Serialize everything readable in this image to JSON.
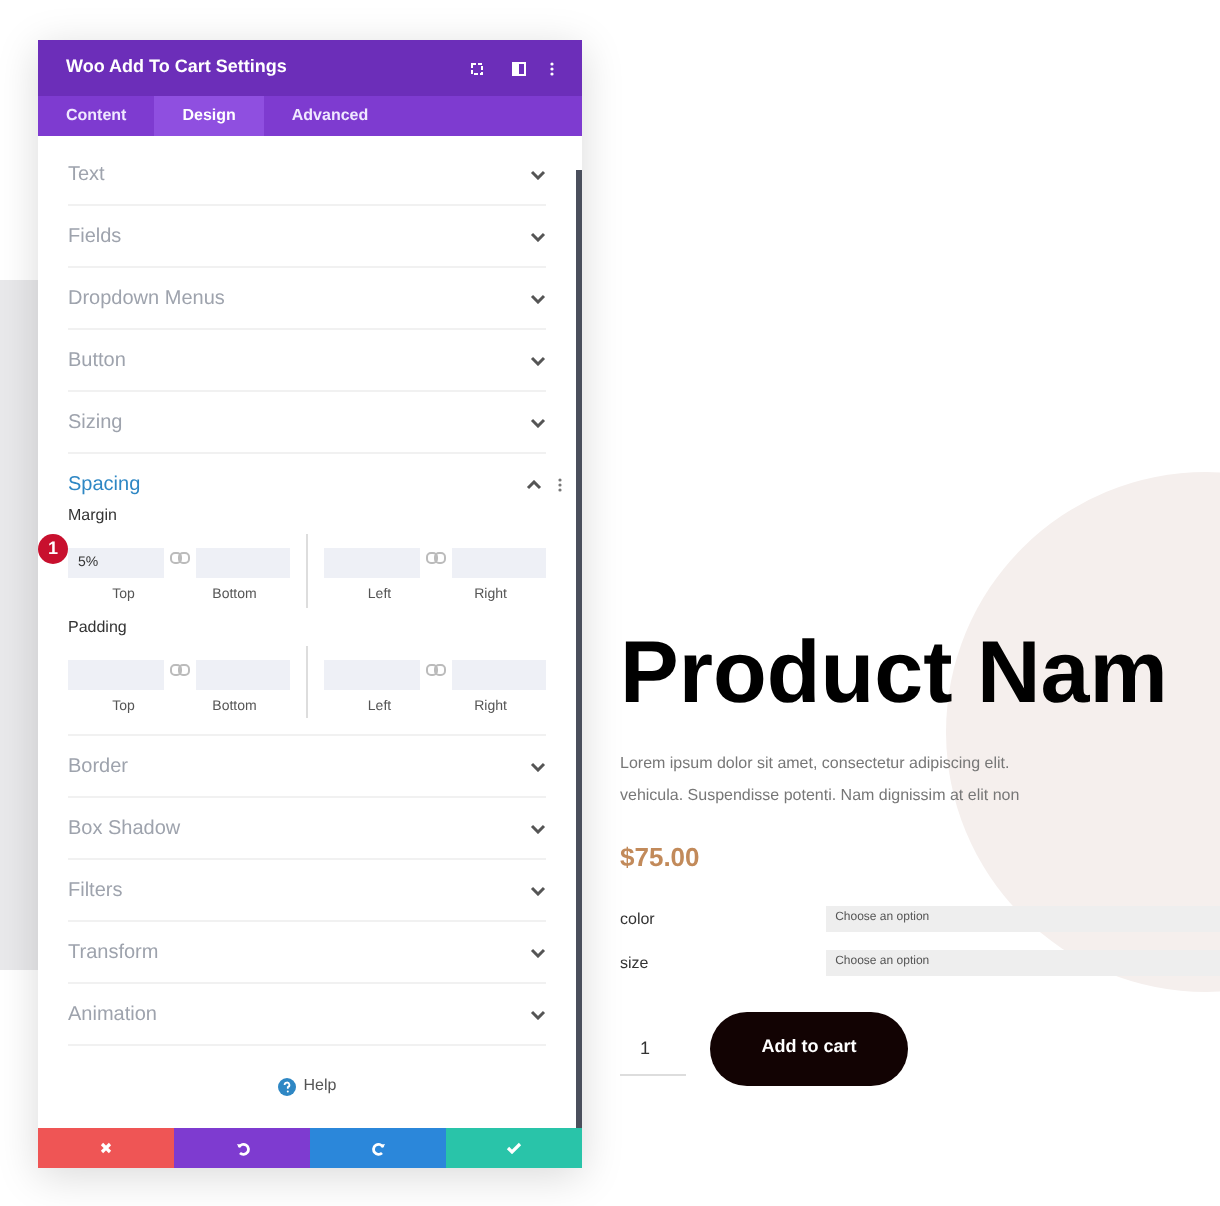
{
  "panel": {
    "title": "Woo Add To Cart Settings",
    "tabs": [
      {
        "label": "Content",
        "selected": false
      },
      {
        "label": "Design",
        "selected": true
      },
      {
        "label": "Advanced",
        "selected": false
      }
    ],
    "sections": [
      {
        "label": "Text",
        "expanded": false
      },
      {
        "label": "Fields",
        "expanded": false
      },
      {
        "label": "Dropdown Menus",
        "expanded": false
      },
      {
        "label": "Button",
        "expanded": false
      },
      {
        "label": "Sizing",
        "expanded": false
      },
      {
        "label": "Spacing",
        "expanded": true,
        "groups": [
          {
            "label": "Margin",
            "fields": [
              {
                "caption": "Top",
                "value": "5%"
              },
              {
                "caption": "Bottom"
              },
              {
                "caption": "Left"
              },
              {
                "caption": "Right"
              }
            ]
          },
          {
            "label": "Padding",
            "fields": [
              {
                "caption": "Top"
              },
              {
                "caption": "Bottom"
              },
              {
                "caption": "Left"
              },
              {
                "caption": "Right"
              }
            ]
          }
        ]
      },
      {
        "label": "Border",
        "expanded": false
      },
      {
        "label": "Box Shadow",
        "expanded": false
      },
      {
        "label": "Filters",
        "expanded": false
      },
      {
        "label": "Transform",
        "expanded": false
      },
      {
        "label": "Animation",
        "expanded": false
      }
    ],
    "help": "Help",
    "step_badge": "1"
  },
  "product": {
    "name": "Product Nam",
    "description": [
      "Lorem ipsum dolor sit amet, consectetur adipiscing elit.",
      "vehicula. Suspendisse potenti. Nam dignissim at elit non"
    ],
    "price": "$75.00",
    "options": [
      {
        "label": "color",
        "placeholder": "Choose an option"
      },
      {
        "label": "size",
        "placeholder": "Choose an option"
      }
    ],
    "quantity": "1",
    "button": "Add to cart"
  }
}
